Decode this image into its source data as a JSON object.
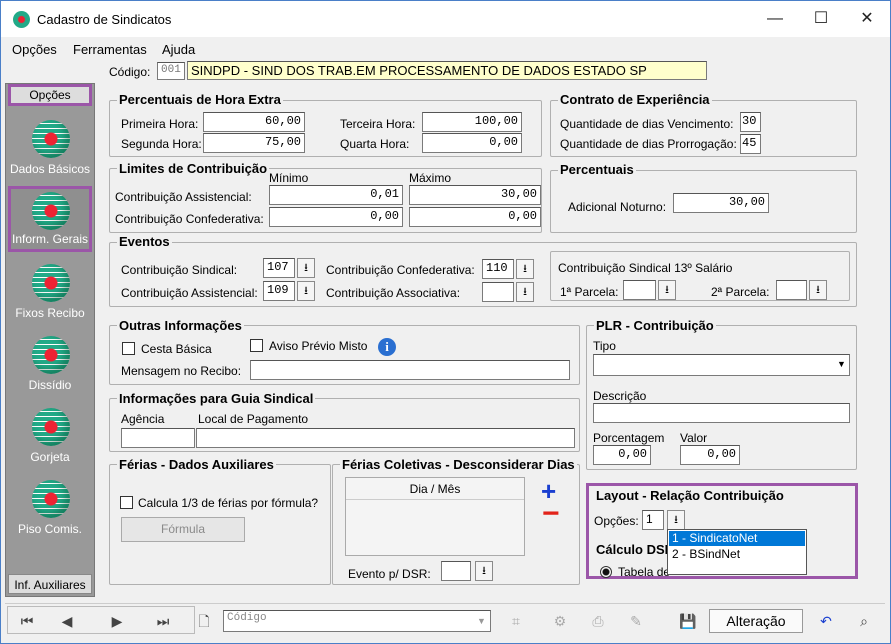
{
  "window": {
    "title": "Cadastro de Sindicatos",
    "minimize": "—",
    "maximize": "☐",
    "close": "✕"
  },
  "menu": [
    "Opções",
    "Ferramentas",
    "Ajuda"
  ],
  "codigo": {
    "label": "Código:",
    "value": "001",
    "name": "SINDPD - SIND DOS TRAB.EM PROCESSAMENTO DE DADOS ESTADO SP"
  },
  "sidebar": {
    "header": "Opções",
    "items": [
      "Dados Básicos",
      "Inform. Gerais",
      "Fixos Recibo",
      "Dissídio",
      "Gorjeta",
      "Piso Comis."
    ],
    "footer": "Inf. Auxiliares"
  },
  "hora_extra": {
    "title": "Percentuais de Hora Extra",
    "primeira_label": "Primeira Hora:",
    "primeira": "60,00",
    "segunda_label": "Segunda Hora:",
    "segunda": "75,00",
    "terceira_label": "Terceira Hora:",
    "terceira": "100,00",
    "quarta_label": "Quarta Hora:",
    "quarta": "0,00"
  },
  "contrato": {
    "title": "Contrato de Experiência",
    "venc_label": "Quantidade de dias Vencimento:",
    "venc": "30",
    "prorr_label": "Quantidade de dias Prorrogação:",
    "prorr": "45"
  },
  "limites": {
    "title": "Limites de Contribuição",
    "min_label": "Mínimo",
    "max_label": "Máximo",
    "assist_label": "Contribuição Assistencial:",
    "assist_min": "0,01",
    "assist_max": "30,00",
    "confed_label": "Contribuição Confederativa:",
    "confed_min": "0,00",
    "confed_max": "0,00"
  },
  "percentuais": {
    "title": "Percentuais",
    "noturno_label": "Adicional Noturno:",
    "noturno": "30,00"
  },
  "eventos": {
    "title": "Eventos",
    "sindical_label": "Contribuição Sindical:",
    "sindical": "107",
    "assistencial_label": "Contribuição Assistencial:",
    "assistencial": "109",
    "confederativa_label": "Contribuição Confederativa:",
    "confederativa": "110",
    "associativa_label": "Contribuição Associativa:",
    "associativa": "",
    "decimo_label": "Contribuição Sindical 13º Salário",
    "parcela1_label": "1ª Parcela:",
    "parcela2_label": "2ª Parcela:"
  },
  "outras": {
    "title": "Outras Informações",
    "cesta": "Cesta Básica",
    "aviso": "Aviso Prévio Misto",
    "mensagem_label": "Mensagem no Recibo:"
  },
  "plr": {
    "title": "PLR - Contribuição",
    "tipo_label": "Tipo",
    "descricao_label": "Descrição",
    "porcentagem_label": "Porcentagem",
    "porcentagem": "0,00",
    "valor_label": "Valor",
    "valor": "0,00"
  },
  "guia": {
    "title": "Informações para Guia Sindical",
    "agencia_label": "Agência",
    "local_label": "Local de Pagamento"
  },
  "ferias": {
    "title": "Férias - Dados Auxiliares",
    "calc_label": "Calcula 1/3 de férias por fórmula?",
    "formula_btn": "Fórmula"
  },
  "ferias_col": {
    "title": "Férias Coletivas - Desconsiderar Dias",
    "col_header": "Dia / Mês",
    "evento_label": "Evento p/ DSR:"
  },
  "layout": {
    "title": "Layout - Relação Contribuição",
    "opcoes_label": "Opções:",
    "opcoes_value": "1",
    "options": [
      "1 - SindicatoNet",
      "2 - BSindNet"
    ]
  },
  "calculo": {
    "title": "Cálculo DSR",
    "tabela_label": "Tabela de"
  },
  "toolbar": {
    "search_placeholder": "Código",
    "status": "Alteração"
  },
  "colors": {
    "purple": "#9b56a8",
    "selected": "#0078d7",
    "input_yellow": "#ffffcc"
  }
}
